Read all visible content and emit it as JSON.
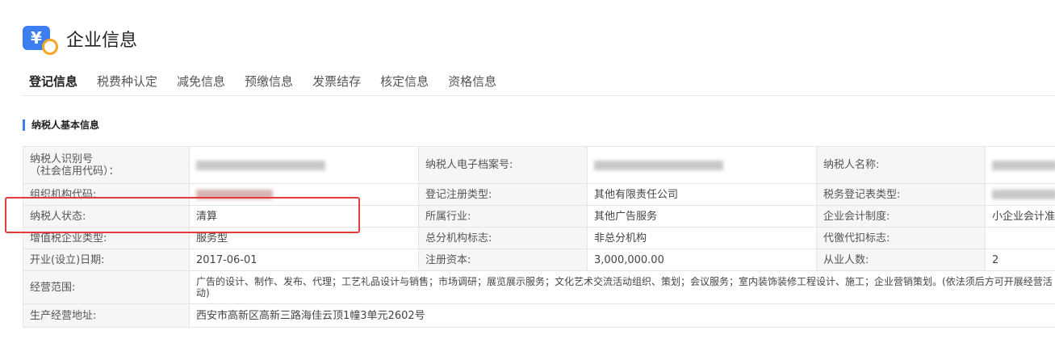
{
  "header": {
    "title": "企业信息",
    "logo_glyph": "¥"
  },
  "tabs": [
    {
      "label": "登记信息",
      "active": true
    },
    {
      "label": "税费种认定"
    },
    {
      "label": "减免信息"
    },
    {
      "label": "预缴信息"
    },
    {
      "label": "发票结存"
    },
    {
      "label": "核定信息"
    },
    {
      "label": "资格信息"
    }
  ],
  "section_title": "纳税人基本信息",
  "table": {
    "row0": {
      "l1": "纳税人识别号\n（社会信用代码）：",
      "l2": "纳税人电子档案号:",
      "l3": "纳税人名称:"
    },
    "row1": {
      "l1": "组织机构代码:",
      "l2": "登记注册类型:",
      "v2": "其他有限责任公司",
      "l3": "税务登记表类型:"
    },
    "row2": {
      "l1": "纳税人状态:",
      "v1": "清算",
      "l2": "所属行业:",
      "v2": "其他广告服务",
      "l3": "企业会计制度:",
      "v3": "小企业会计准"
    },
    "row3": {
      "l1": "增值税企业类型:",
      "v1": "服务型",
      "l2": "总分机构标志:",
      "v2": "非总分机构",
      "l3": "代徼代扣标志:",
      "v3": ""
    },
    "row4": {
      "l1": "开业(设立)日期:",
      "v1": "2017-06-01",
      "l2": "注册资本:",
      "v2": "3,000,000.00",
      "l3": "从业人数:",
      "v3": "2"
    },
    "row5": {
      "l1": "经营范围:",
      "v1": "广告的设计、制作、发布、代理；工艺礼品设计与销售；市场调研；展览展示服务；文化艺术交流活动组织、策划；会议服务；室内装饰装修工程设计、施工；企业营销策划。(依法须后方可开展经营活动)"
    },
    "row6": {
      "l1": "生产经营地址:",
      "v1": "西安市高新区高新三路海佳云顶1幢3单元2602号"
    }
  },
  "colors": {
    "accent": "#3d7ef0",
    "highlight": "#e23b3b",
    "label_bg": "#f5f6f7"
  }
}
